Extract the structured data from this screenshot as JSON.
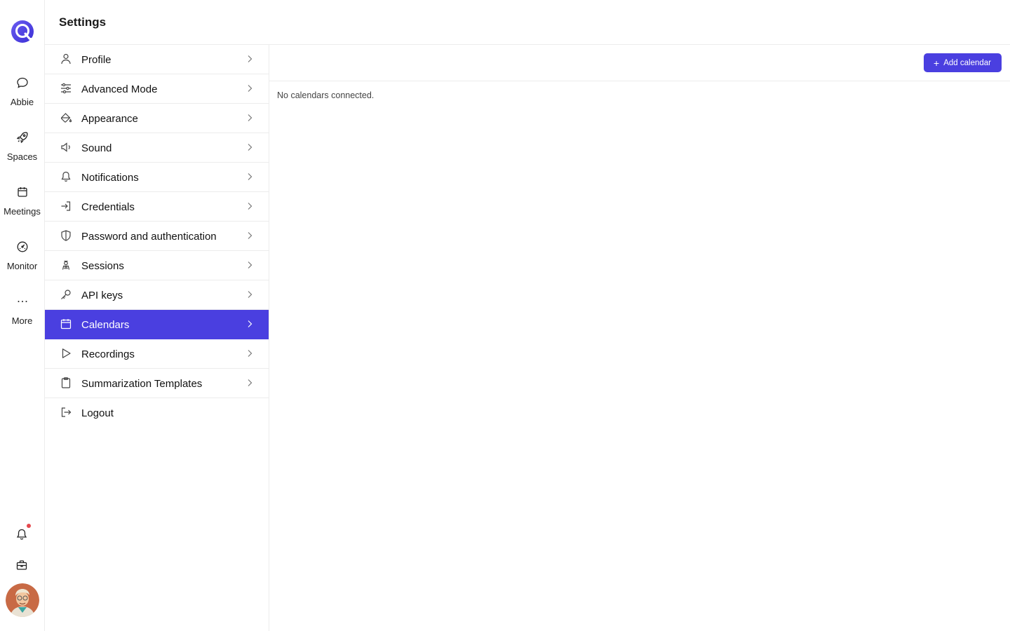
{
  "header": {
    "title": "Settings"
  },
  "rail": {
    "items": [
      {
        "label": "Abbie",
        "icon": "chat-bubble-icon"
      },
      {
        "label": "Spaces",
        "icon": "rocket-icon"
      },
      {
        "label": "Meetings",
        "icon": "calendar-icon"
      },
      {
        "label": "Monitor",
        "icon": "gauge-icon"
      },
      {
        "label": "More",
        "icon": "ellipsis-icon"
      }
    ],
    "bottom": [
      "bell-icon",
      "briefcase-icon"
    ],
    "notification_dot_color": "#e5484d"
  },
  "menu": {
    "items": [
      {
        "label": "Profile",
        "icon": "user-icon"
      },
      {
        "label": "Advanced Mode",
        "icon": "sliders-icon"
      },
      {
        "label": "Appearance",
        "icon": "paint-bucket-icon"
      },
      {
        "label": "Sound",
        "icon": "speaker-icon"
      },
      {
        "label": "Notifications",
        "icon": "bell-icon"
      },
      {
        "label": "Credentials",
        "icon": "login-icon"
      },
      {
        "label": "Password and authentication",
        "icon": "shield-icon"
      },
      {
        "label": "Sessions",
        "icon": "person-badge-icon"
      },
      {
        "label": "API keys",
        "icon": "key-icon"
      },
      {
        "label": "Calendars",
        "icon": "calendar-icon",
        "active": true
      },
      {
        "label": "Recordings",
        "icon": "play-icon"
      },
      {
        "label": "Summarization Templates",
        "icon": "clipboard-icon"
      },
      {
        "label": "Logout",
        "icon": "logout-icon"
      }
    ]
  },
  "content": {
    "add_button_label": "Add calendar",
    "empty_message": "No calendars connected."
  },
  "colors": {
    "accent": "#4a3fe0",
    "border": "#ececec"
  }
}
